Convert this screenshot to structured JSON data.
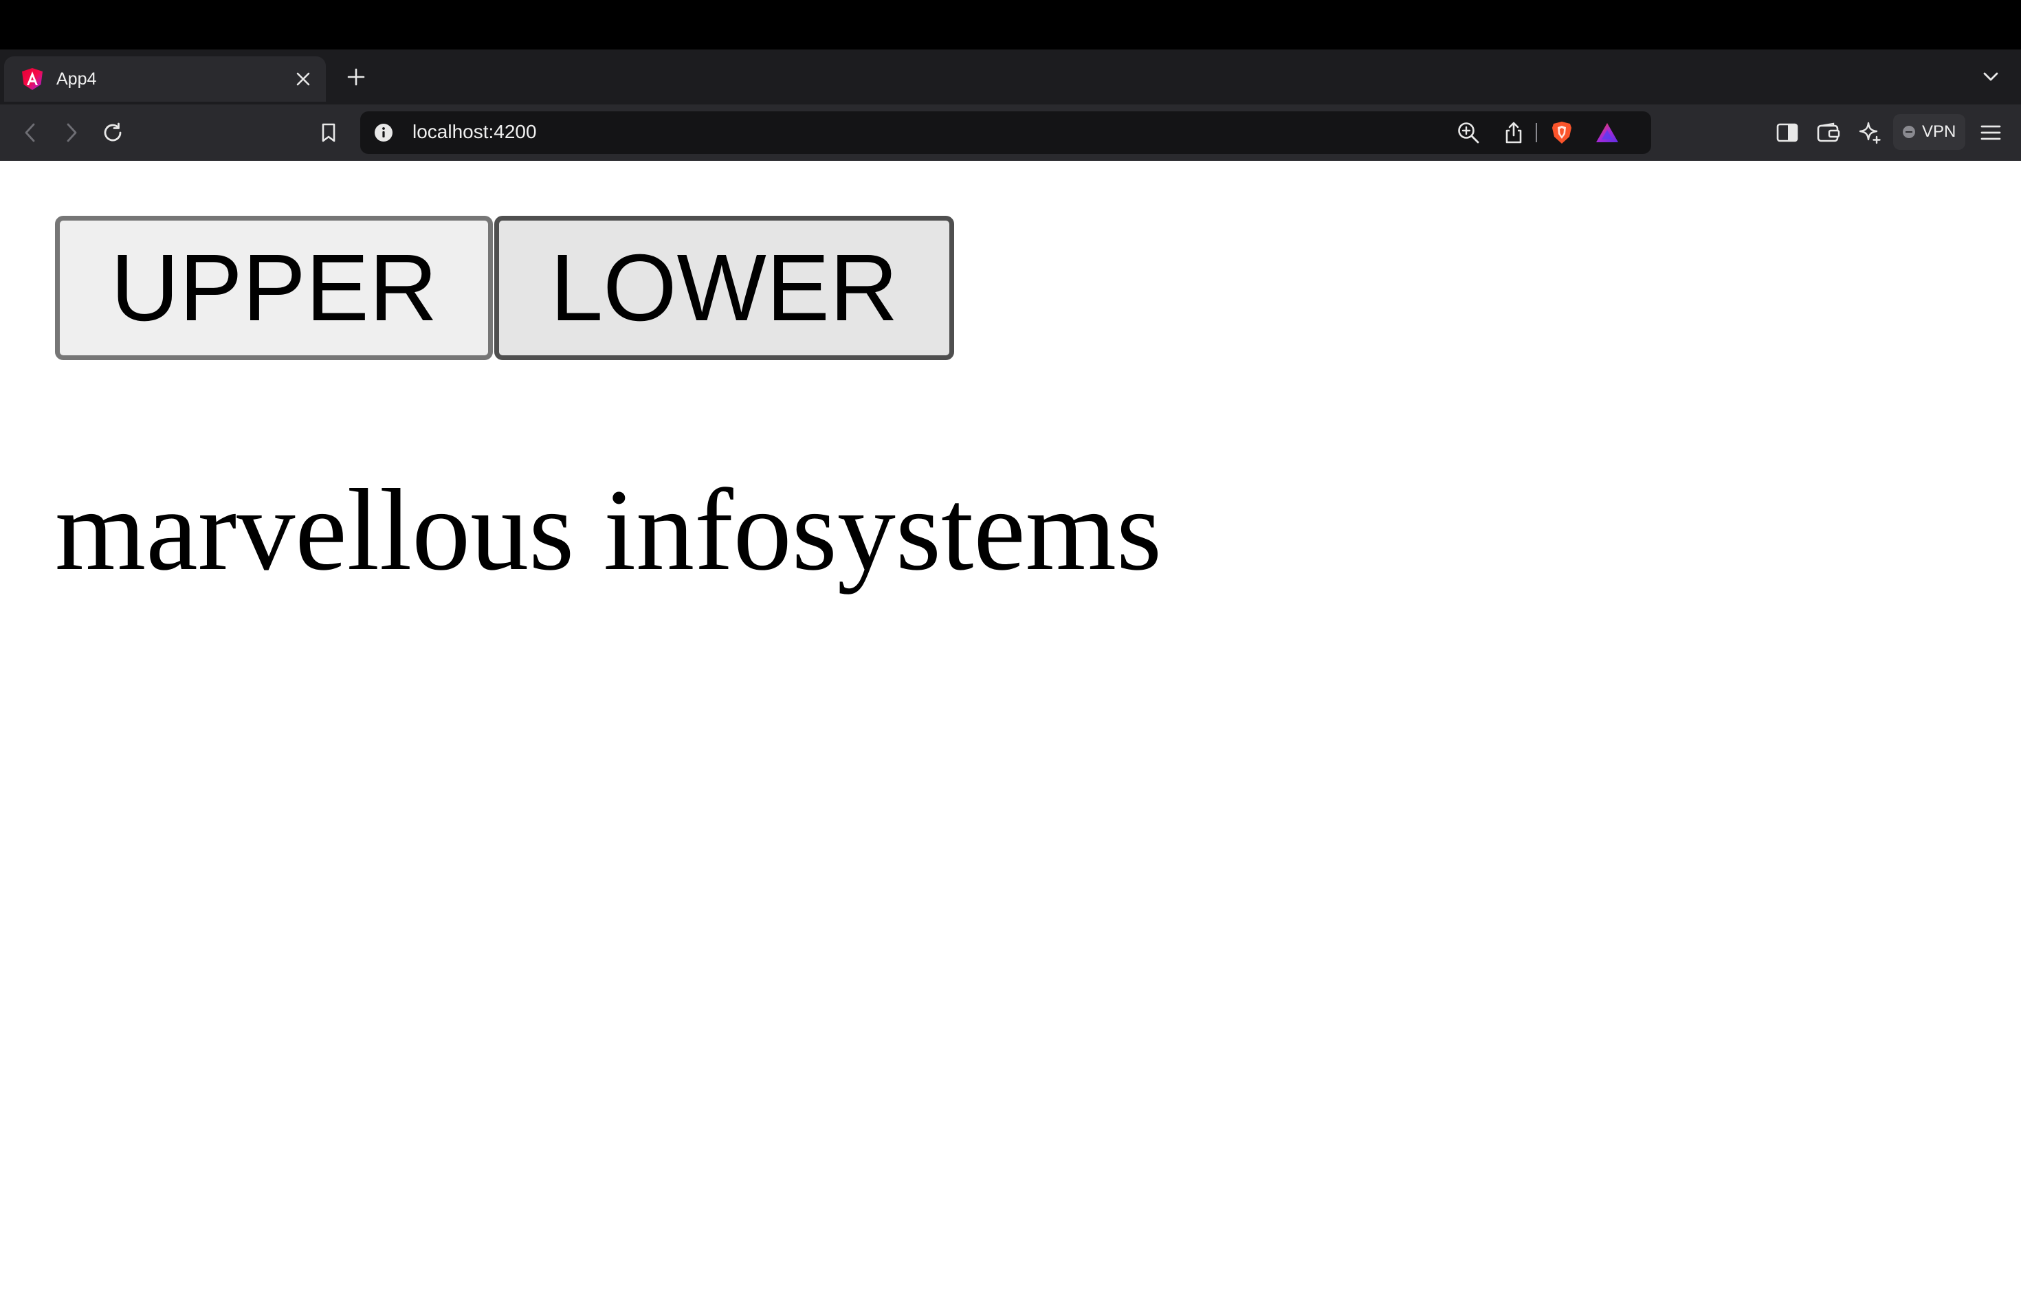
{
  "browser": {
    "tab": {
      "title": "App4",
      "icon": "angular-logo-icon",
      "close_icon": "close-icon"
    },
    "new_tab_icon": "plus-icon",
    "tab_list_icon": "chevron-down-icon",
    "nav": {
      "back_icon": "chevron-left-icon",
      "forward_icon": "chevron-right-icon",
      "reload_icon": "reload-icon",
      "bookmark_icon": "bookmark-icon"
    },
    "address": {
      "url": "localhost:4200",
      "info_icon": "info-icon",
      "zoom_icon": "zoom-in-icon",
      "share_icon": "share-icon",
      "shields_icon": "brave-shields-icon",
      "rewards_icon": "brave-rewards-icon"
    },
    "toolbar_right": {
      "sidebar_icon": "sidebar-icon",
      "wallet_icon": "wallet-icon",
      "leo_icon": "leo-ai-icon",
      "vpn_label": "VPN",
      "menu_icon": "hamburger-menu-icon"
    }
  },
  "page": {
    "buttons": {
      "upper_label": "UPPER",
      "lower_label": "LOWER"
    },
    "display_text": "marvellous infosystems"
  },
  "colors": {
    "tab_strip": "#1c1c1f",
    "toolbar": "#2a2a2e",
    "urlbar": "#141416",
    "button_bg": "#efefef",
    "button_border": "#767676",
    "brave_orange": "#fb542b"
  }
}
